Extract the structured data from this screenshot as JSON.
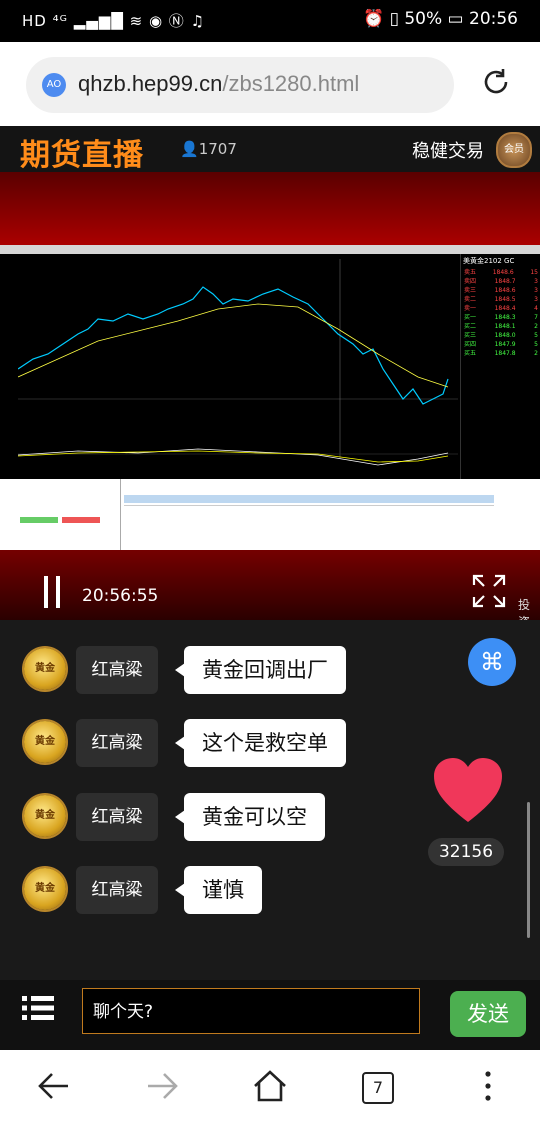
{
  "status_bar": {
    "left_icons": "HD ⁴ᴳ ▂▄▆█ ≋ ◉ Ⓝ ♫",
    "battery": "50%",
    "time": "20:56"
  },
  "browser": {
    "url_domain": "qhzb.hep99.cn",
    "url_path": "/zbs1280.html",
    "site_icon_text": "AO"
  },
  "header": {
    "logo_text": "期货直播",
    "viewer_count": "1707",
    "right_text": "稳健交易",
    "member_badge": "会员"
  },
  "chart_screen": {
    "instrument": "美黄金2102 GC",
    "quote_rows": [
      [
        "卖五",
        "1848.6",
        "15"
      ],
      [
        "卖四",
        "1848.7",
        "3"
      ],
      [
        "卖三",
        "1848.6",
        "3"
      ],
      [
        "卖二",
        "1848.5",
        "3"
      ],
      [
        "卖一",
        "1848.4",
        "4"
      ],
      [
        "买一",
        "1848.3",
        "7"
      ],
      [
        "买二",
        "1848.1",
        "2"
      ],
      [
        "买三",
        "1848.0",
        "5"
      ],
      [
        "买四",
        "1847.9",
        "5"
      ],
      [
        "买五",
        "1847.8",
        "2"
      ]
    ]
  },
  "video": {
    "time": "20:56:55",
    "side_text": "投资"
  },
  "chat": {
    "messages": [
      {
        "user": "红高粱",
        "badge": "黄金",
        "text": "黄金回调出厂"
      },
      {
        "user": "红高粱",
        "badge": "黄金",
        "text": "这个是救空单"
      },
      {
        "user": "红高粱",
        "badge": "黄金",
        "text": "黄金可以空"
      },
      {
        "user": "红高粱",
        "badge": "黄金",
        "text": "谨慎"
      }
    ],
    "likes": "32156",
    "input_value": "聊个天?",
    "send_label": "发送"
  },
  "nav": {
    "tab_count": "7"
  },
  "colors": {
    "send_green": "#4caf50",
    "fab_blue": "#3d8ff5",
    "logo_orange": "#ff8c1a",
    "heart_red": "#f0375a"
  }
}
